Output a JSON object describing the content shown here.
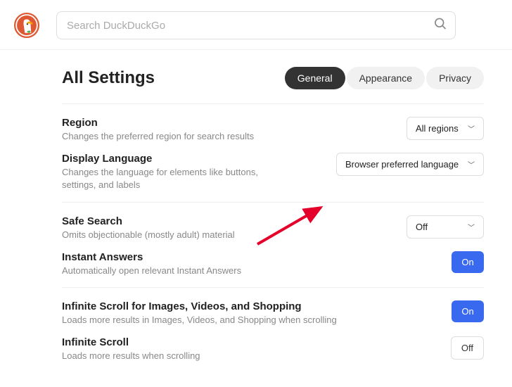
{
  "search": {
    "placeholder": "Search DuckDuckGo"
  },
  "page_title": "All Settings",
  "tabs": {
    "general": "General",
    "appearance": "Appearance",
    "privacy": "Privacy"
  },
  "sections": {
    "region": {
      "title": "Region",
      "desc": "Changes the preferred region for search results",
      "value": "All regions"
    },
    "display_language": {
      "title": "Display Language",
      "desc": "Changes the language for elements like buttons, settings, and labels",
      "value": "Browser preferred language"
    },
    "safe_search": {
      "title": "Safe Search",
      "desc": "Omits objectionable (mostly adult) material",
      "value": "Off"
    },
    "instant_answers": {
      "title": "Instant Answers",
      "desc": "Automatically open relevant Instant Answers",
      "state": "On"
    },
    "infinite_scroll_media": {
      "title": "Infinite Scroll for Images, Videos, and Shopping",
      "desc": "Loads more results in Images, Videos, and Shopping when scrolling",
      "state": "On"
    },
    "infinite_scroll": {
      "title": "Infinite Scroll",
      "desc": "Loads more results when scrolling",
      "state": "Off"
    }
  }
}
